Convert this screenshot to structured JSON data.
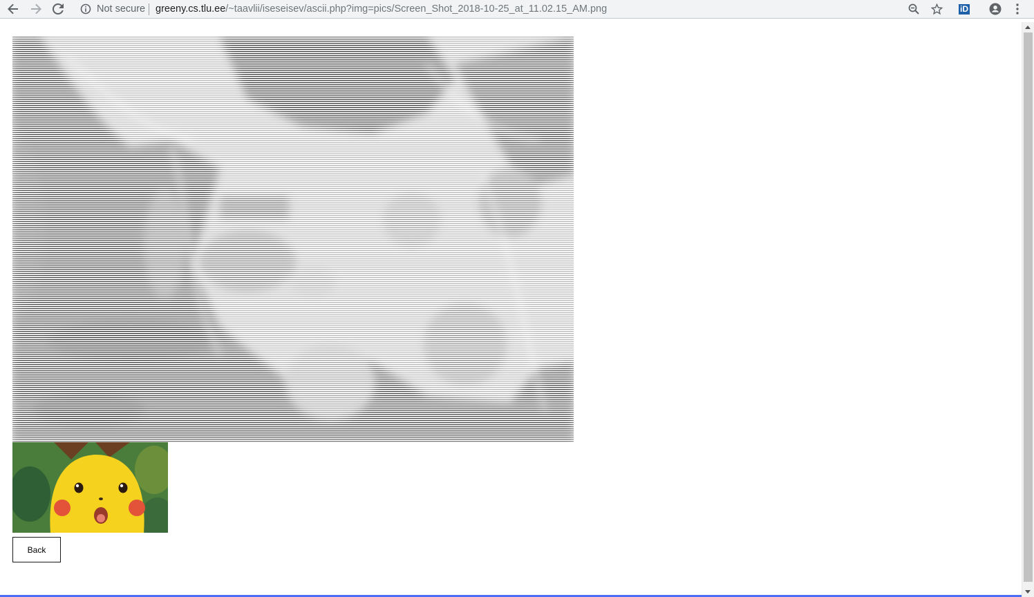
{
  "browser": {
    "security_label": "Not secure",
    "url_host": "greeny.cs.tlu.ee",
    "url_path": "/~taavlii/iseseisev/ascii.php?img=pics/Screen_Shot_2018-10-25_at_11.02.15_AM.png",
    "icons": [
      "back-arrow-icon",
      "forward-arrow-icon",
      "reload-icon",
      "info-icon",
      "zoom-icon",
      "star-icon",
      "id-extension-icon",
      "account-icon",
      "menu-icon"
    ],
    "extension_label": "iD"
  },
  "page": {
    "ascii_art_description_alt": "",
    "back_button_label": "Back"
  },
  "colors": {
    "toolbar_bg": "#f1f3f4",
    "ascii_ink": "#1a1a1a",
    "pikachu_yellow": "#f5d21e",
    "background_green": "#3b7a3e"
  }
}
